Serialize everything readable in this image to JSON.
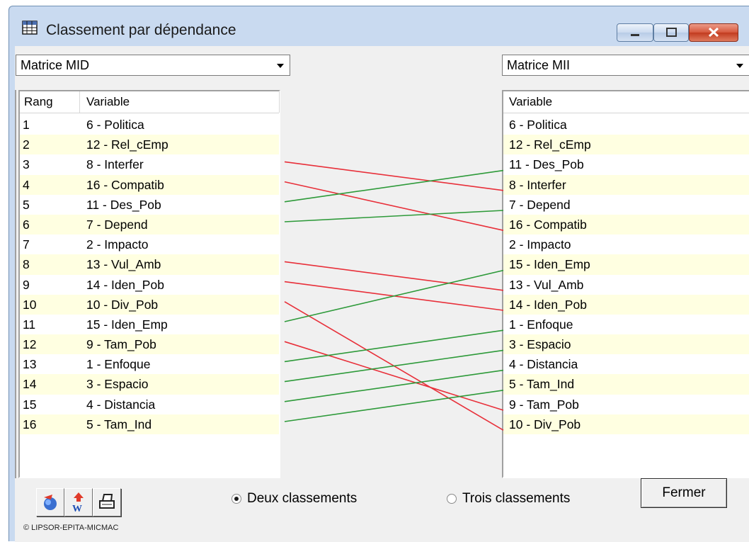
{
  "window": {
    "title": "Classement par dépendance"
  },
  "left_select": {
    "value": "Matrice MID"
  },
  "right_select": {
    "value": "Matrice MII"
  },
  "left_table": {
    "headers": [
      "Rang",
      "Variable"
    ],
    "rows": [
      {
        "rank": "1",
        "var": "6 - Politica"
      },
      {
        "rank": "2",
        "var": "12 - Rel_cEmp"
      },
      {
        "rank": "3",
        "var": "8 - Interfer"
      },
      {
        "rank": "4",
        "var": "16 - Compatib"
      },
      {
        "rank": "5",
        "var": "11 - Des_Pob"
      },
      {
        "rank": "6",
        "var": "7 - Depend"
      },
      {
        "rank": "7",
        "var": "2 - Impacto"
      },
      {
        "rank": "8",
        "var": "13 - Vul_Amb"
      },
      {
        "rank": "9",
        "var": "14 - Iden_Pob"
      },
      {
        "rank": "10",
        "var": "10 - Div_Pob"
      },
      {
        "rank": "11",
        "var": "15 - Iden_Emp"
      },
      {
        "rank": "12",
        "var": "9 - Tam_Pob"
      },
      {
        "rank": "13",
        "var": "1 - Enfoque"
      },
      {
        "rank": "14",
        "var": "3 - Espacio"
      },
      {
        "rank": "15",
        "var": "4 - Distancia"
      },
      {
        "rank": "16",
        "var": "5 - Tam_Ind"
      }
    ]
  },
  "right_table": {
    "headers": [
      "Variable"
    ],
    "rows": [
      "6 - Politica",
      "12 - Rel_cEmp",
      "11 - Des_Pob",
      "8 - Interfer",
      "7 - Depend",
      "16 - Compatib",
      "2 - Impacto",
      "15 - Iden_Emp",
      "13 - Vul_Amb",
      "14 - Iden_Pob",
      "1 - Enfoque",
      "3 - Espacio",
      "4 - Distancia",
      "5 - Tam_Ind",
      "9 - Tam_Pob",
      "10 - Div_Pob"
    ]
  },
  "links": {
    "colors": {
      "down": "#e8303a",
      "up": "#2e9a3a"
    },
    "pairs": [
      {
        "from": 3,
        "to": 4,
        "dir": "down"
      },
      {
        "from": 4,
        "to": 6,
        "dir": "down"
      },
      {
        "from": 5,
        "to": 3,
        "dir": "up"
      },
      {
        "from": 6,
        "to": 5,
        "dir": "up"
      },
      {
        "from": 8,
        "to": 9,
        "dir": "down"
      },
      {
        "from": 9,
        "to": 10,
        "dir": "down"
      },
      {
        "from": 10,
        "to": 16,
        "dir": "down"
      },
      {
        "from": 11,
        "to": 8,
        "dir": "up"
      },
      {
        "from": 12,
        "to": 15,
        "dir": "down"
      },
      {
        "from": 13,
        "to": 11,
        "dir": "up"
      },
      {
        "from": 14,
        "to": 12,
        "dir": "up"
      },
      {
        "from": 15,
        "to": 13,
        "dir": "up"
      },
      {
        "from": 16,
        "to": 14,
        "dir": "up"
      }
    ]
  },
  "radios": {
    "option1": "Deux classements",
    "option2": "Trois classements",
    "selected": 1
  },
  "buttons": {
    "close": "Fermer"
  },
  "footer": {
    "copyright": "© LIPSOR-EPITA-MICMAC"
  }
}
